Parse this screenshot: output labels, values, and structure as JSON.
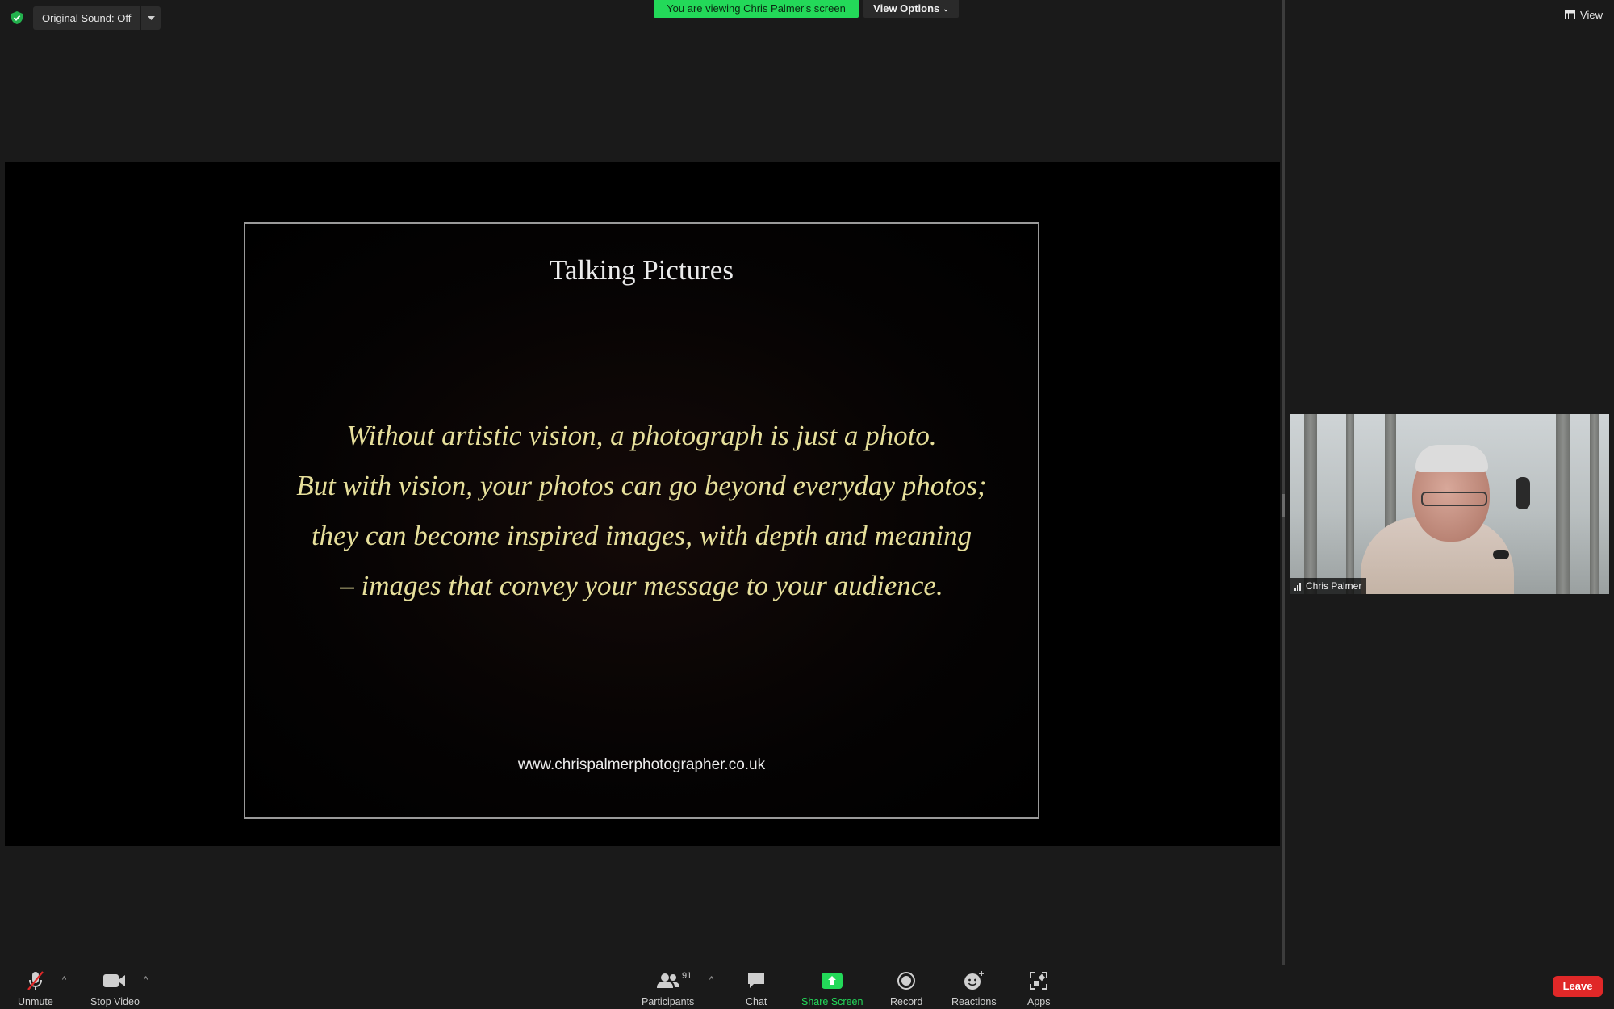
{
  "top_bar": {
    "original_sound_label": "Original Sound: Off",
    "viewing_banner": "You are viewing Chris Palmer's screen",
    "view_options_label": "View Options",
    "view_label": "View"
  },
  "slide": {
    "title": "Talking Pictures",
    "lines": [
      "Without artistic vision, a photograph is just a photo.",
      "But with vision, your photos can go beyond everyday photos;",
      "they can become inspired images, with depth and meaning",
      "– images that convey your message to your audience."
    ],
    "url": "www.chrispalmerphotographer.co.uk"
  },
  "participant": {
    "name": "Chris Palmer"
  },
  "toolbar": {
    "unmute": "Unmute",
    "stop_video": "Stop Video",
    "participants": "Participants",
    "participant_count": "91",
    "chat": "Chat",
    "share_screen": "Share Screen",
    "record": "Record",
    "reactions": "Reactions",
    "apps": "Apps",
    "leave": "Leave"
  },
  "colors": {
    "banner_green": "#23d959",
    "leave_red": "#e02828",
    "slide_text_yellow": "#e6df9b"
  }
}
